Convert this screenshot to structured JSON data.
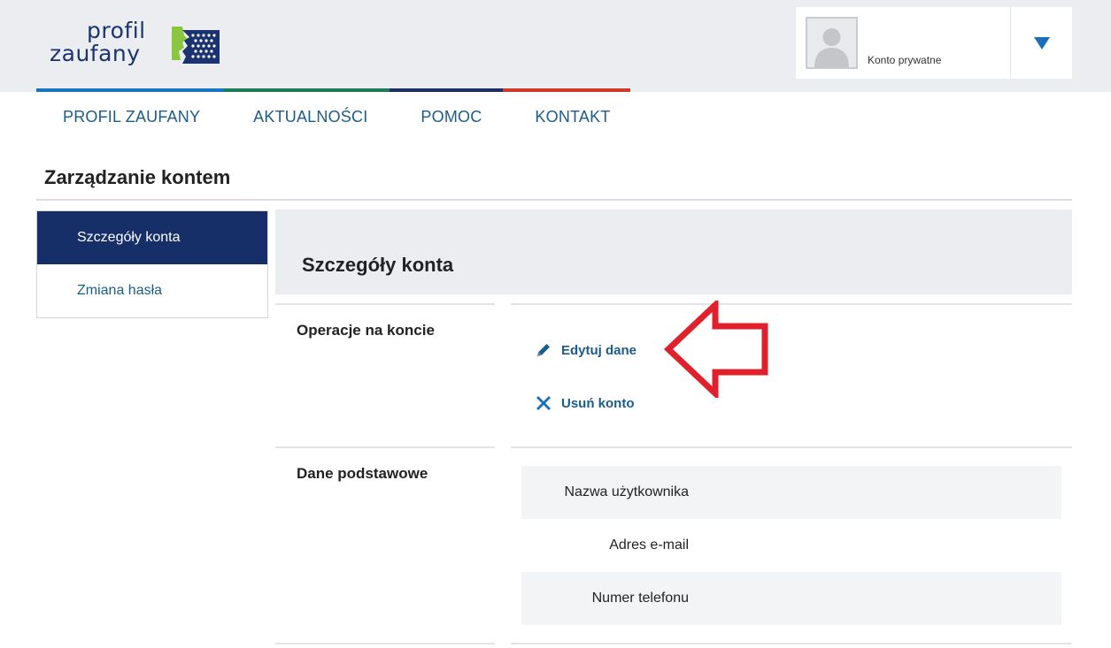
{
  "header": {
    "logo": {
      "word1": "profil",
      "word2": "zaufany"
    },
    "account": {
      "label": "Konto prywatne"
    },
    "colors": {
      "blue": "#1a75c0",
      "green": "#1f7a57",
      "navy": "#1c2f66",
      "red": "#cf3a2b"
    }
  },
  "nav": {
    "items": [
      {
        "label": "PROFIL ZAUFANY"
      },
      {
        "label": "AKTUALNOŚCI"
      },
      {
        "label": "POMOC"
      },
      {
        "label": "KONTAKT"
      }
    ]
  },
  "page": {
    "title": "Zarządzanie kontem"
  },
  "sidebar": {
    "items": [
      {
        "label": "Szczegóły konta",
        "active": true
      },
      {
        "label": "Zmiana hasła",
        "active": false
      }
    ]
  },
  "panel": {
    "title": "Szczegóły konta",
    "operations": {
      "label": "Operacje na koncie",
      "edit": {
        "label": "Edytuj dane",
        "icon": "pencil-icon"
      },
      "delete": {
        "label": "Usuń konto",
        "icon": "close-icon"
      }
    },
    "basic": {
      "label": "Dane podstawowe",
      "rows": [
        {
          "label": "Nazwa użytkownika"
        },
        {
          "label": "Adres e-mail"
        },
        {
          "label": "Numer telefonu"
        }
      ]
    }
  },
  "annotation": {
    "icon": "arrow-left-icon",
    "color": "#e0212b"
  }
}
